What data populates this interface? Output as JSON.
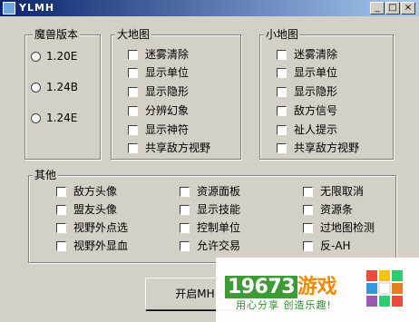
{
  "window": {
    "title": "YLMH",
    "buttons": {
      "minimize": "_",
      "maximize": "□",
      "close": "×"
    }
  },
  "version_group": {
    "legend": "魔兽版本",
    "options": [
      {
        "label": "1.20E"
      },
      {
        "label": "1.24B"
      },
      {
        "label": "1.24E"
      }
    ]
  },
  "big_map_group": {
    "legend": "大地图",
    "items": [
      "迷雾清除",
      "显示单位",
      "显示隐形",
      "分辨幻象",
      "显示神符",
      "共享敌方视野"
    ]
  },
  "mini_map_group": {
    "legend": "小地图",
    "items": [
      "迷雾清除",
      "显示单位",
      "显示隐形",
      "敌方信号",
      "祉人提示",
      "共享敌方视野"
    ]
  },
  "other_group": {
    "legend": "其他",
    "col1": [
      "敌方头像",
      "盟友头像",
      "视野外点选",
      "视野外显血"
    ],
    "col2": [
      "资源面板",
      "显示技能",
      "控制单位",
      "允许交易"
    ],
    "col3": [
      "无限取消",
      "资源条",
      "过地图检测",
      "反-AH"
    ]
  },
  "start_button": {
    "label": "开启MH"
  },
  "watermark": {
    "logo_number": "19673",
    "logo_word": "游戏",
    "tagline": "用心分享 创造乐趣!"
  },
  "colors": {
    "titlebar_start": "#0a246a",
    "face": "#d4d0c8",
    "watermark_green": "#3d9b35",
    "watermark_orange": "#f08a00"
  }
}
